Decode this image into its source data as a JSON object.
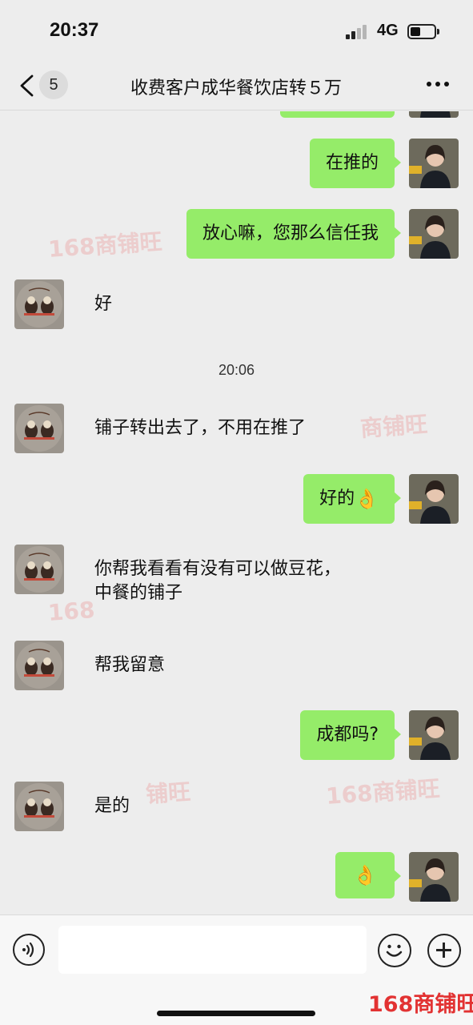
{
  "status_bar": {
    "time": "20:37",
    "network": "4G",
    "colors": {
      "signal_active": "#222222",
      "signal_inactive": "#b5b5b5"
    }
  },
  "nav": {
    "unread_count": "5",
    "title": "收费客户成华餐饮店转５万"
  },
  "chat": {
    "bubble_color": "#95ec69",
    "messages": [
      {
        "sender": "me",
        "text": "在推的"
      },
      {
        "sender": "me",
        "text": "放心嘛，您那么信任我"
      },
      {
        "sender": "them",
        "text": "好"
      },
      {
        "type": "timestamp",
        "text": "20:06"
      },
      {
        "sender": "them",
        "text": "铺子转出去了，不用在推了"
      },
      {
        "sender": "me",
        "text": "好的",
        "emoji": "ok-hand-icon"
      },
      {
        "sender": "them",
        "line1": "你帮我看看有没有可以做豆花，",
        "line2": "中餐的铺子"
      },
      {
        "sender": "them",
        "text": "帮我留意"
      },
      {
        "sender": "me",
        "text": "成都吗?"
      },
      {
        "sender": "them",
        "text": "是的"
      },
      {
        "sender": "me",
        "emoji": "ok-hand-icon"
      }
    ]
  },
  "watermarks": {
    "w1": "168商铺旺",
    "w2": "商铺旺",
    "w3": "168",
    "w4": "铺旺",
    "w5": "168商铺旺"
  },
  "input_bar": {
    "text_value": "",
    "brand": "168商铺旺"
  }
}
